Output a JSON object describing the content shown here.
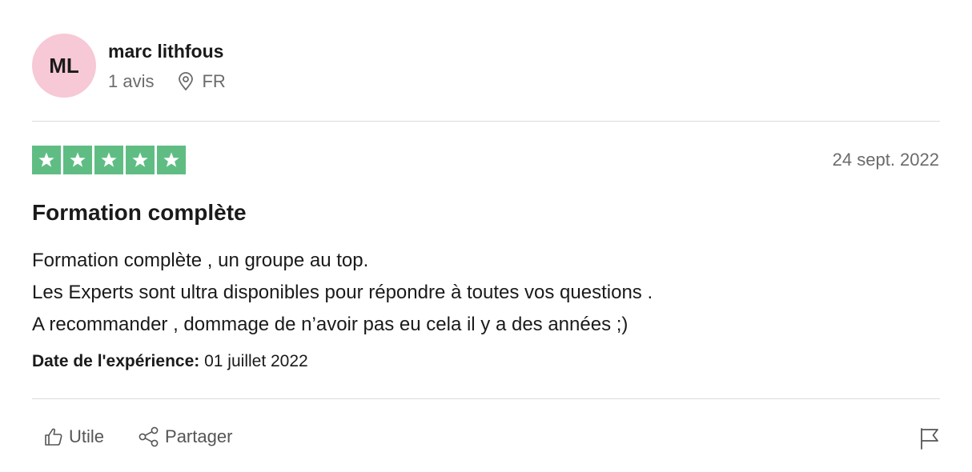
{
  "review": {
    "avatar_initials": "ML",
    "avatar_color": "#f7c8d6",
    "user_name": "marc lithfous",
    "review_count": "1 avis",
    "country": "FR",
    "rating": 5,
    "rating_max": 5,
    "star_color": "#5fbd84",
    "date": "24 sept. 2022",
    "title": "Formation complète",
    "body_lines": [
      "Formation complète , un groupe au top.",
      "Les Experts sont ultra disponibles pour répondre à toutes vos questions .",
      "A recommander , dommage de n’avoir pas eu cela il y a des années ;)"
    ],
    "experience_label": "Date de l'expérience:",
    "experience_date": "01 juillet 2022"
  },
  "actions": {
    "useful_label": "Utile",
    "share_label": "Partager"
  },
  "icons": {
    "location": "location-pin-icon",
    "star": "star-icon",
    "useful": "thumbs-up-icon",
    "share": "share-icon",
    "report": "flag-icon"
  }
}
